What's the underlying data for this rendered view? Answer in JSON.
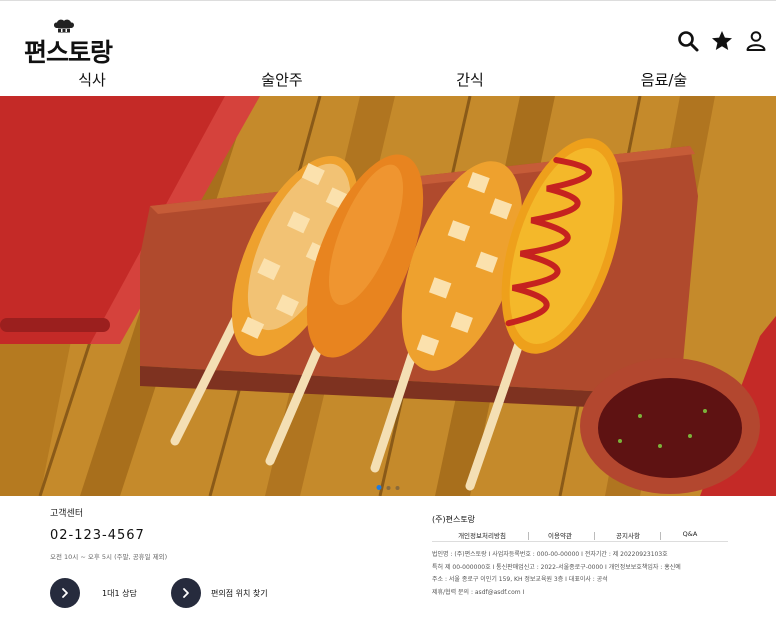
{
  "header": {
    "logo_text": "편스토랑",
    "icons": [
      "search-icon",
      "star-icon",
      "user-icon"
    ]
  },
  "nav": {
    "items": [
      "식사",
      "술안주",
      "간식",
      "음료/술"
    ]
  },
  "hero": {
    "slide_count": 3,
    "active_slide": 1
  },
  "footer": {
    "cs_title": "고객센터",
    "phone": "02-123-4567",
    "hours": "오전 10시 ~ 오후 5시 (주말, 공휴일 제외)",
    "button_consult": "1대1 상담",
    "button_store": "편의점 위치 찾기",
    "company_name": "(주)편스토랑",
    "policy_links": [
      "개인정보처리방침",
      "이용약관",
      "공지사항",
      "Q&A"
    ],
    "info_lines": [
      "법인명 : (주)편스토랑 I 사업자등록번호 : 000-00-00000 I 전자기간 : 제 20220923103호",
      "특허 제 00-000000호 I 통신판매업신고 : 2022-서울종로구-0000 I 개인정보보호책임자 : 홍신예",
      "주소 : 서울 종로구 이인기 159, KH 정보교육원 3층 I 대표이사 : 공석",
      "제휴/협력 문의 : asdf@asdf.com I"
    ]
  },
  "colors": {
    "button_bg": "#262b3d",
    "active_dot": "#1e7be0"
  }
}
